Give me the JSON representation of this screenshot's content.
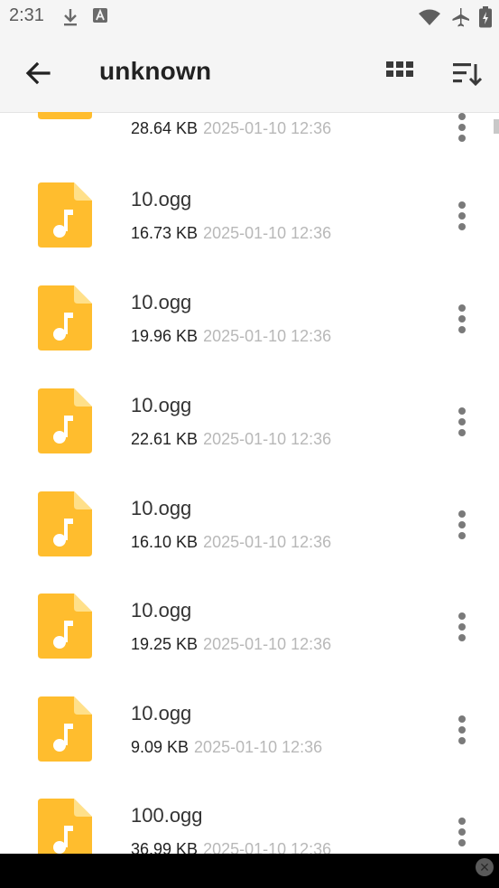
{
  "status_bar": {
    "time": "2:31",
    "left_icons": [
      "download-icon",
      "text-a-icon"
    ],
    "right_icons": [
      "wifi-icon",
      "airplane-icon",
      "battery-icon"
    ]
  },
  "app_bar": {
    "title": "unknown",
    "back_icon": "arrow-back-icon",
    "grid_icon": "grid-view-icon",
    "sort_icon": "sort-icon"
  },
  "files": [
    {
      "name": "",
      "size": "28.64 KB",
      "date": "2025-01-10 12:36"
    },
    {
      "name": "10.ogg",
      "size": "16.73 KB",
      "date": "2025-01-10 12:36"
    },
    {
      "name": "10.ogg",
      "size": "19.96 KB",
      "date": "2025-01-10 12:36"
    },
    {
      "name": "10.ogg",
      "size": "22.61 KB",
      "date": "2025-01-10 12:36"
    },
    {
      "name": "10.ogg",
      "size": "16.10 KB",
      "date": "2025-01-10 12:36"
    },
    {
      "name": "10.ogg",
      "size": "19.25 KB",
      "date": "2025-01-10 12:36"
    },
    {
      "name": "10.ogg",
      "size": "9.09 KB",
      "date": "2025-01-10 12:36"
    },
    {
      "name": "100.ogg",
      "size": "36.99 KB",
      "date": "2025-01-10 12:36"
    }
  ],
  "colors": {
    "file_icon": "#FFBD2E",
    "file_icon_fold": "#FFE08A",
    "date_text": "#B8B8B8"
  }
}
